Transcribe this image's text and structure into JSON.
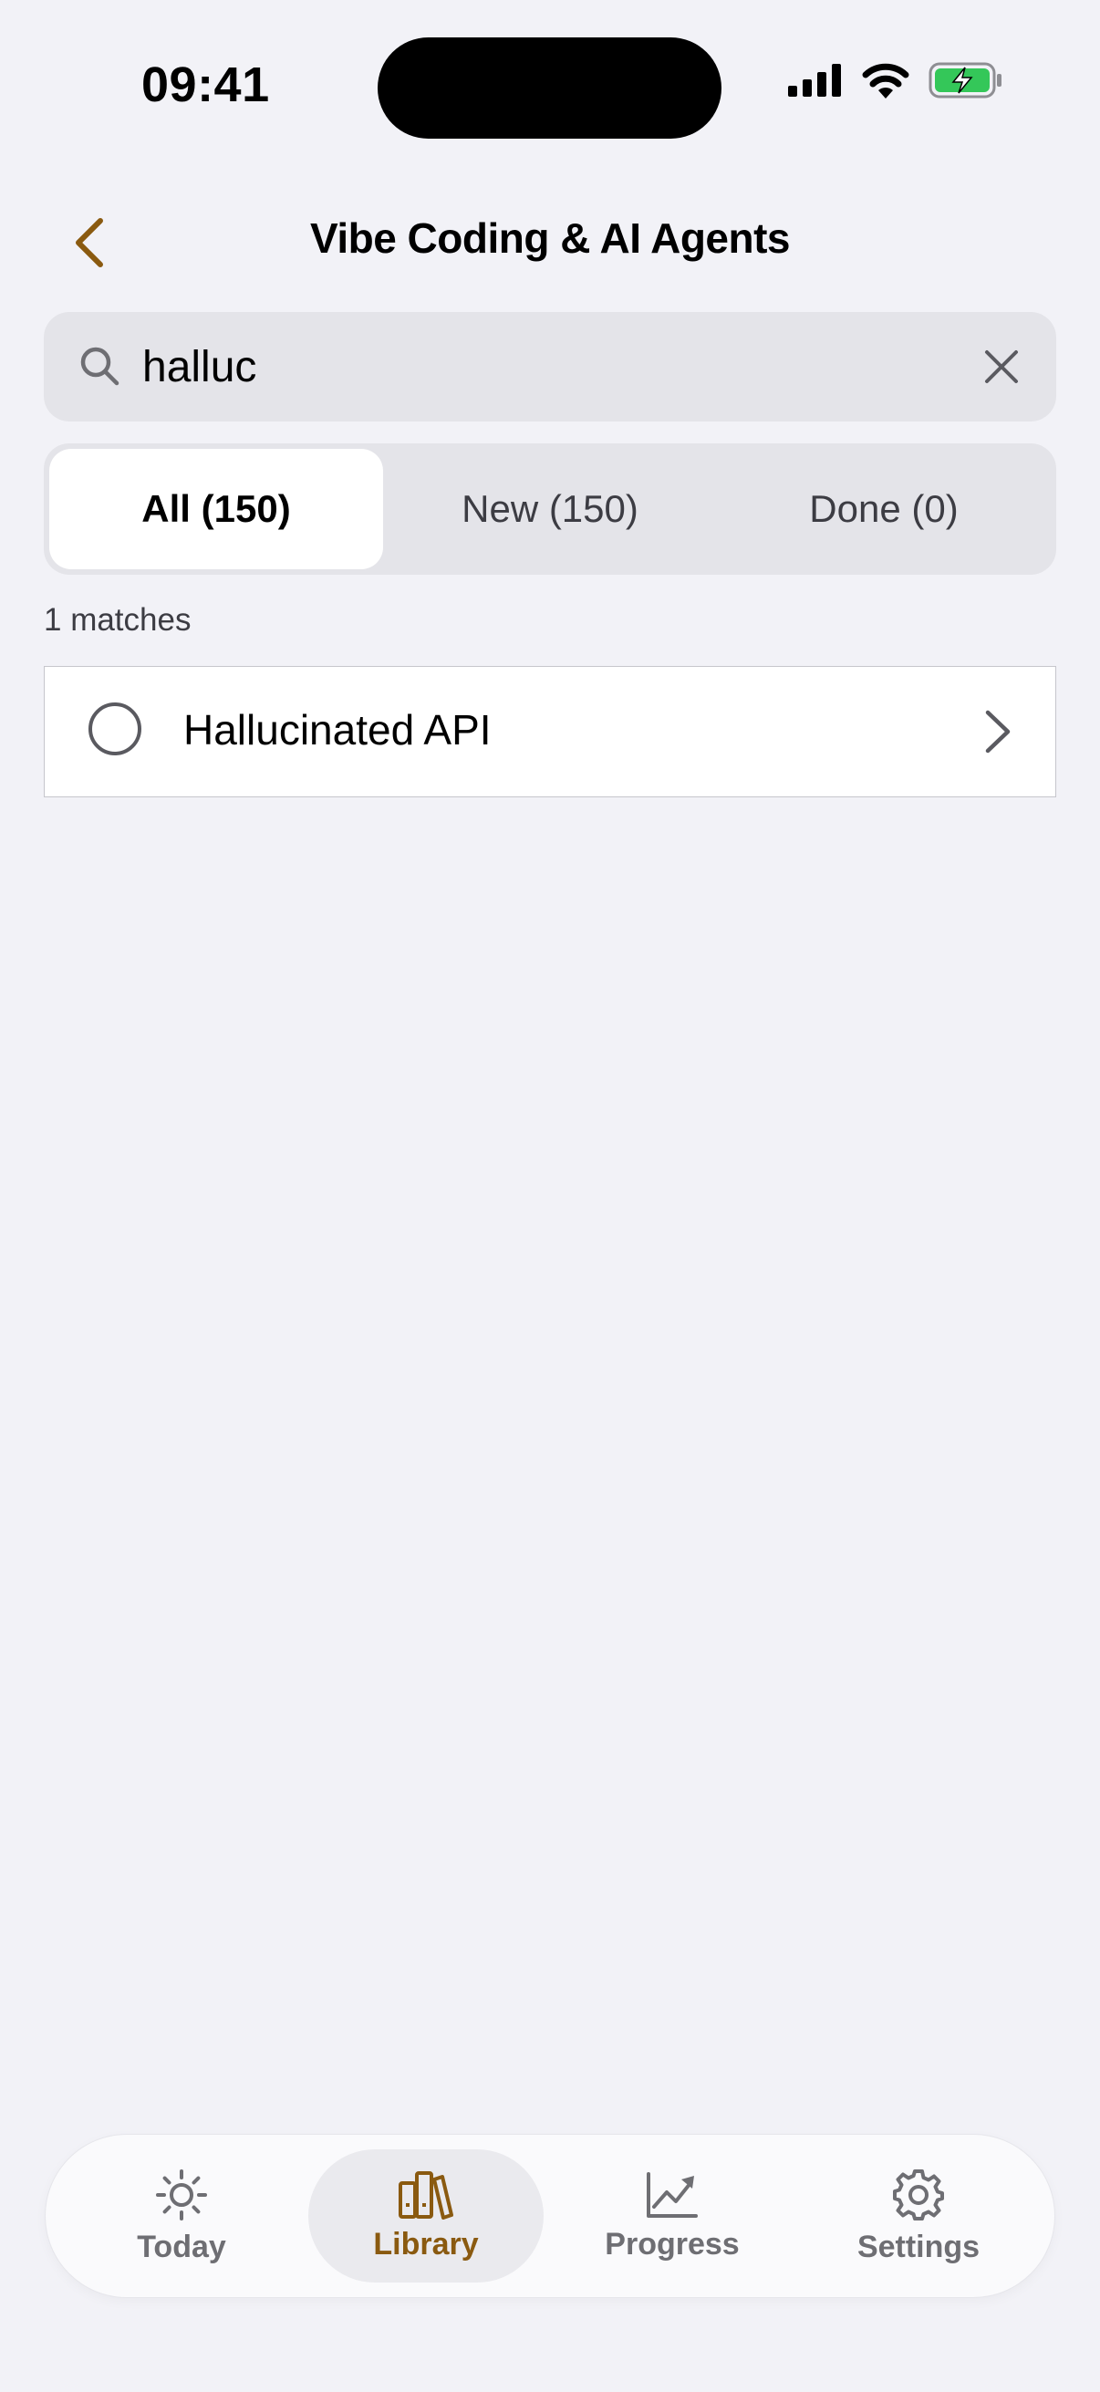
{
  "status_bar": {
    "time": "09:41"
  },
  "header": {
    "title": "Vibe Coding & AI Agents",
    "back_icon": "chevron-left-icon"
  },
  "search": {
    "value": "halluc",
    "placeholder": "Search"
  },
  "filters": {
    "all": "All (150)",
    "new": "New (150)",
    "done": "Done (0)",
    "selected": "all"
  },
  "results": {
    "count_label": "1 matches",
    "items": [
      {
        "label": "Hallucinated API"
      }
    ]
  },
  "tab_bar": {
    "tabs": [
      {
        "label": "Today",
        "icon": "sun-icon"
      },
      {
        "label": "Library",
        "icon": "books-icon"
      },
      {
        "label": "Progress",
        "icon": "chart-line-icon"
      },
      {
        "label": "Settings",
        "icon": "gear-icon"
      }
    ],
    "active": "Library"
  },
  "colors": {
    "accent": "#8A5A10",
    "background": "#F2F2F7",
    "battery": "#34C759"
  }
}
